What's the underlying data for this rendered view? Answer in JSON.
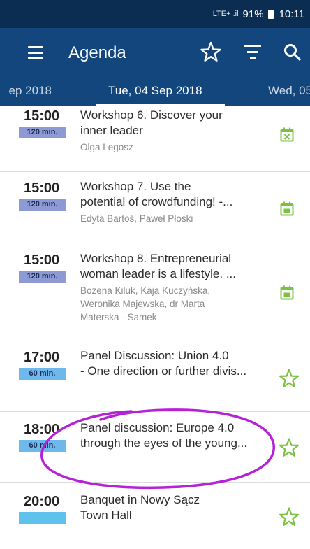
{
  "status": {
    "signal": "LTE+ .il",
    "battery": "91%",
    "time": "10:11"
  },
  "appbar": {
    "title": "Agenda"
  },
  "dates": {
    "prev": "ep 2018",
    "current": "Tue, 04 Sep 2018",
    "next": "Wed, 05"
  },
  "items": [
    {
      "time": "15:00",
      "duration": "120 min.",
      "title_line1": "Workshop 6. Discover your",
      "title_line2": "inner leader",
      "speakers_line1": "Olga Legosz",
      "speakers_line2": "",
      "speakers_line3": "",
      "action": "calendar-remove"
    },
    {
      "time": "15:00",
      "duration": "120 min.",
      "title_line1": "Workshop 7. Use the",
      "title_line2": "potential of crowdfunding! -...",
      "speakers_line1": "Edyta Bartoś, Paweł Płoski",
      "speakers_line2": "",
      "speakers_line3": "",
      "action": "calendar"
    },
    {
      "time": "15:00",
      "duration": "120 min.",
      "title_line1": "Workshop 8. Entrepreneurial",
      "title_line2": "woman leader is a lifestyle. ...",
      "speakers_line1": "Bożena Kiluk, Kaja Kuczyńska,",
      "speakers_line2": "Weronika Majewska, dr Marta",
      "speakers_line3": "Materska - Samek",
      "action": "calendar"
    },
    {
      "time": "17:00",
      "duration": "60 min.",
      "title_line1": "Panel Discussion: Union 4.0",
      "title_line2": "- One direction or further divis...",
      "action": "star"
    },
    {
      "time": "18:00",
      "duration": "60 min.",
      "title_line1": "Panel discussion: Europe 4.0",
      "title_line2": "through the eyes of the young...",
      "action": "star"
    },
    {
      "time": "20:00",
      "duration": "",
      "title_line1": "Banquet in Nowy Sącz",
      "title_line2": "Town Hall",
      "action": "star"
    }
  ],
  "colors": {
    "statusbar": "#0b2d52",
    "appbar": "#12467c",
    "accent_green": "#7cc242",
    "annotation": "#b522d6"
  }
}
